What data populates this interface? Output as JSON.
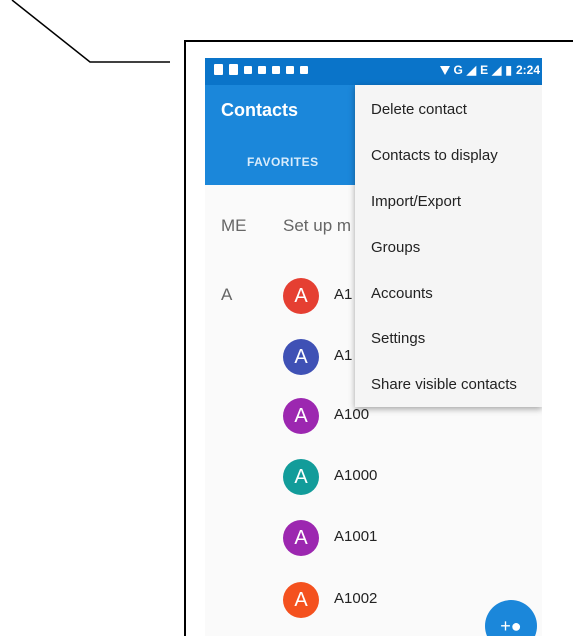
{
  "status_bar": {
    "network": "G",
    "network2": "E",
    "time": "2:24"
  },
  "app_bar": {
    "title": "Contacts",
    "tab_favorites": "FAVORITES"
  },
  "me_row": {
    "label": "ME",
    "text": "Set up m"
  },
  "section_a": "A",
  "contacts": [
    {
      "initial": "A",
      "name": "A1",
      "color": "#e53f32"
    },
    {
      "initial": "A",
      "name": "A1",
      "color": "#3f51b5"
    },
    {
      "initial": "A",
      "name": "A100",
      "color": "#9c27b0"
    },
    {
      "initial": "A",
      "name": "A1000",
      "color": "#129c9a"
    },
    {
      "initial": "A",
      "name": "A1001",
      "color": "#9c27b0"
    },
    {
      "initial": "A",
      "name": "A1002",
      "color": "#f4511e"
    }
  ],
  "menu": {
    "items": [
      "Delete contact",
      "Contacts to display",
      "Import/Export",
      "Groups",
      "Accounts",
      "Settings",
      "Share visible contacts"
    ]
  },
  "fab_icon": "add-contact-icon"
}
